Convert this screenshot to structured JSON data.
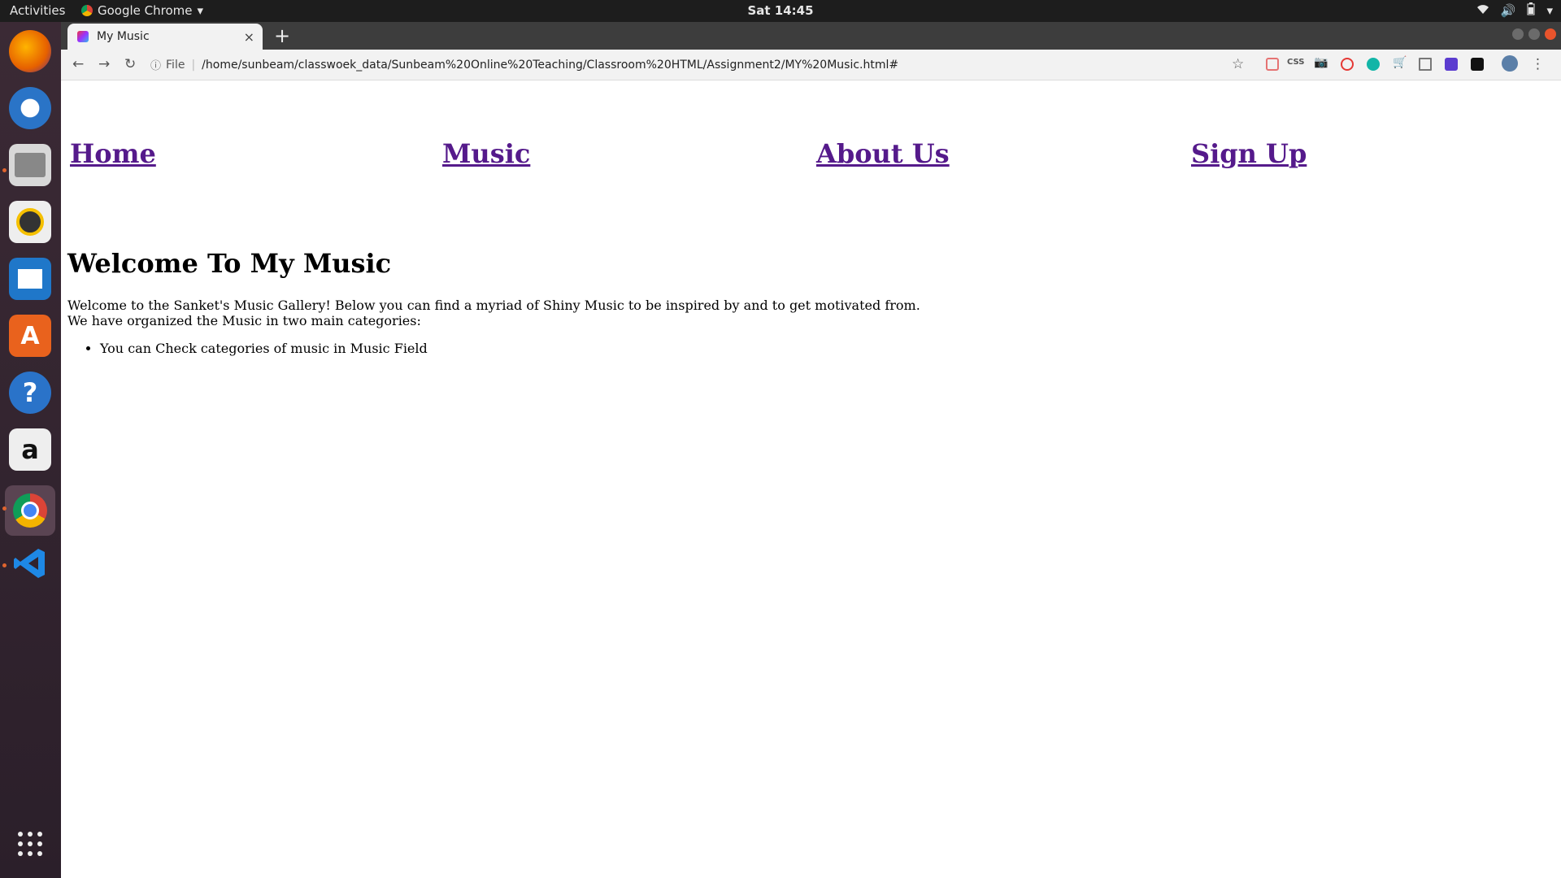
{
  "system": {
    "activities_label": "Activities",
    "app_name": "Google Chrome",
    "clock": "Sat 14:45"
  },
  "browser": {
    "tab_title": "My Music",
    "new_tab": "+",
    "close_tab": "×",
    "scheme_label": "File",
    "url": "/home/sunbeam/classwoek_data/Sunbeam%20Online%20Teaching/Classroom%20HTML/Assignment2/MY%20Music.html#",
    "css_ext_label": "CSS"
  },
  "page": {
    "nav": [
      "Home",
      "Music",
      "About Us",
      "Sign Up"
    ],
    "heading": "Welcome To My Music",
    "intro_line1": "Welcome to the Sanket's Music Gallery! Below you can find a myriad of Shiny Music to be inspired by and to get motivated from.",
    "intro_line2": "We have organized the Music in two main categories:",
    "list": [
      "You can Check categories of music in Music Field"
    ]
  },
  "colors": {
    "link_visited": "#551a8b",
    "dock_bg": "#3b2a35",
    "topbar_bg": "#1d1d1d"
  }
}
